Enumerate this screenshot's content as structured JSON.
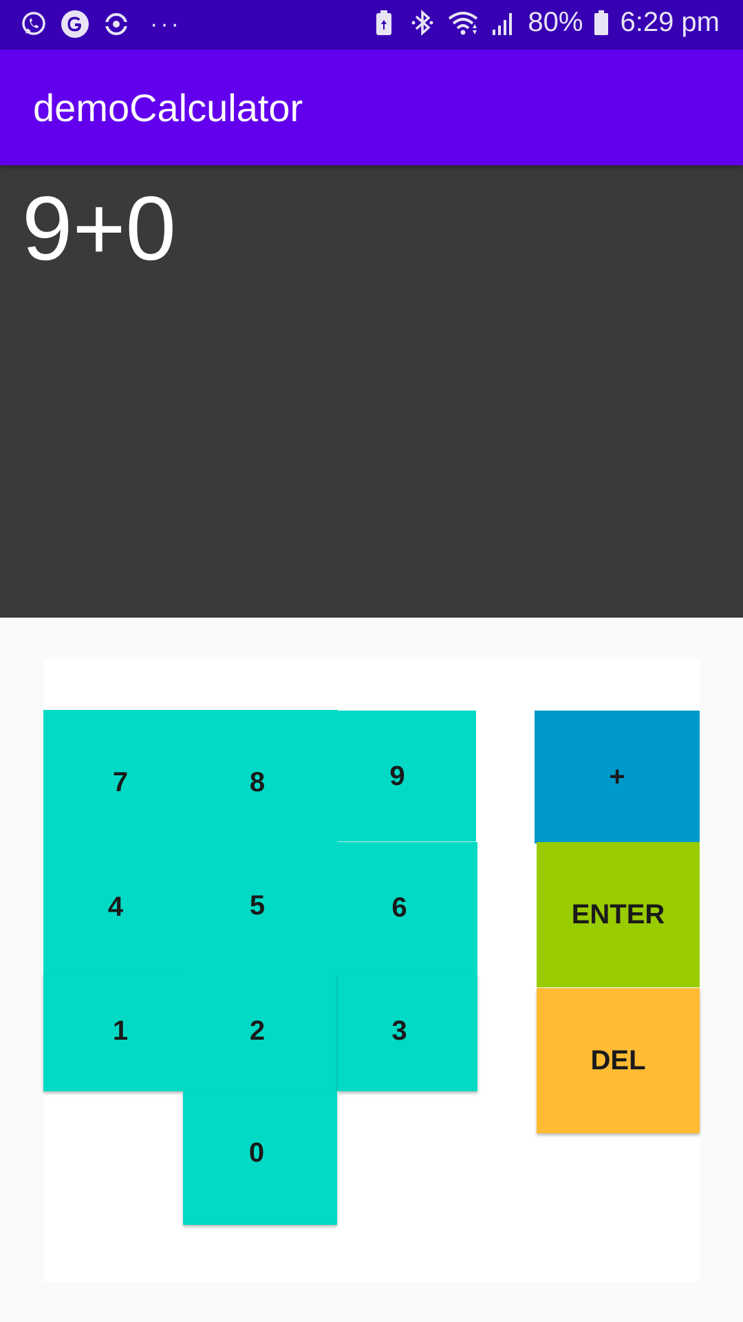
{
  "status_bar": {
    "battery_percent": "80%",
    "time": "6:29 pm",
    "overflow": "···"
  },
  "app_bar": {
    "title": "demoCalculator"
  },
  "display": {
    "expression": "9+0"
  },
  "keypad": {
    "digits": {
      "seven": "7",
      "eight": "8",
      "nine": "9",
      "four": "4",
      "five": "5",
      "six": "6",
      "one": "1",
      "two": "2",
      "three": "3",
      "zero": "0"
    },
    "plus": "+",
    "enter": "ENTER",
    "del": "DEL"
  },
  "colors": {
    "status_bar": "#3700b3",
    "app_bar": "#6200ee",
    "display_bg": "#3a3a3a",
    "digit_keys": "#03dac5",
    "plus_key": "#0099cc",
    "enter_key": "#99cc00",
    "del_key": "#ffbb33"
  },
  "icons": [
    "whatsapp-icon",
    "google-icon",
    "sync-icon",
    "battery-saver-icon",
    "bluetooth-icon",
    "wifi-icon",
    "signal-icon",
    "battery-icon"
  ]
}
